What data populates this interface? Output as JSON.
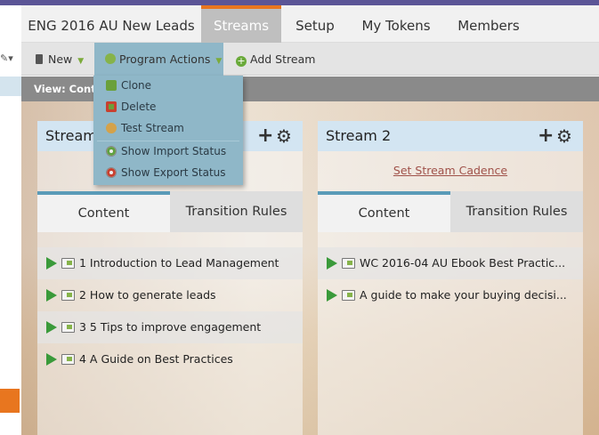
{
  "nav": {
    "tabs": [
      {
        "label": "ENG 2016 AU New Leads"
      },
      {
        "label": "Streams"
      },
      {
        "label": "Setup"
      },
      {
        "label": "My Tokens"
      },
      {
        "label": "Members"
      }
    ]
  },
  "toolbar": {
    "new_label": "New",
    "program_actions_label": "Program Actions",
    "add_stream_label": "Add Stream"
  },
  "viewbar": {
    "label": "View: Conte"
  },
  "menu": {
    "items": [
      {
        "label": "Clone",
        "icon": "clone-icon"
      },
      {
        "label": "Delete",
        "icon": "delete-icon"
      },
      {
        "label": "Test Stream",
        "icon": "test-icon"
      },
      {
        "label": "Show Import Status",
        "icon": "import-icon"
      },
      {
        "label": "Show Export Status",
        "icon": "export-icon"
      }
    ]
  },
  "streams": [
    {
      "title": "Stream",
      "cadence": "",
      "tabs": [
        "Content",
        "Transition Rules"
      ],
      "items": [
        "1 Introduction to Lead Management",
        "2 How to generate leads",
        "3 5 Tips to improve engagement",
        "4 A Guide on Best Practices"
      ]
    },
    {
      "title": "Stream 2",
      "cadence": "Set Stream Cadence",
      "tabs": [
        "Content",
        "Transition Rules"
      ],
      "items": [
        "WC 2016-04 AU Ebook Best Practic...",
        "A guide to make your buying decisi..."
      ]
    }
  ],
  "colors": {
    "accent_orange": "#e8761f",
    "topbar_purple": "#5b5596",
    "menu_blue": "#8fb7c8",
    "stream_header": "#d3e5f2",
    "tab_active_border": "#5a9bb8",
    "play_green": "#3a9a3a"
  }
}
